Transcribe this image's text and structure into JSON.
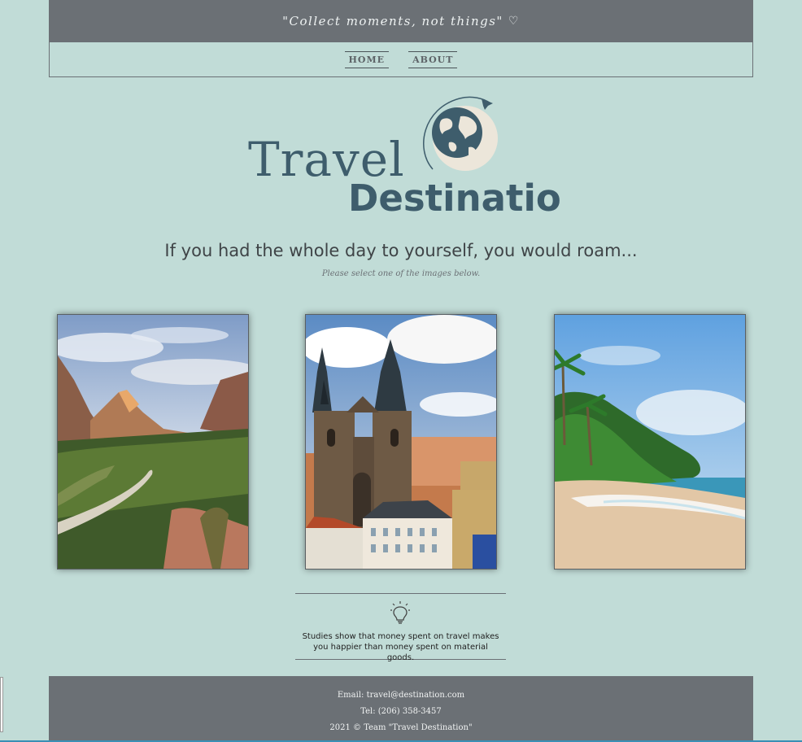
{
  "banner": {
    "quote": "\"Collect moments, not things\"",
    "heart": "♡"
  },
  "nav": {
    "items": [
      "HOME",
      "ABOUT"
    ]
  },
  "logo": {
    "line1": "Travel",
    "line2": "Destination"
  },
  "main": {
    "headline": "If you had the whole day to yourself, you would roam...",
    "subline": "Please select one of the images below."
  },
  "cards": [
    {
      "icon": "canyon-landscape-image"
    },
    {
      "icon": "prague-cathedral-image"
    },
    {
      "icon": "tropical-beach-image"
    }
  ],
  "fact": {
    "icon": "lightbulb-icon",
    "text": "Studies show that money spent on travel makes you happier than money spent on material goods."
  },
  "footer": {
    "email": "Email: travel@destination.com",
    "tel": "Tel: (206) 358-3457",
    "copyright": "2021 © Team \"Travel Destination\""
  },
  "colors": {
    "background": "#c1dcd7",
    "banner": "#6b7075",
    "logo": "#3e5d6c"
  }
}
